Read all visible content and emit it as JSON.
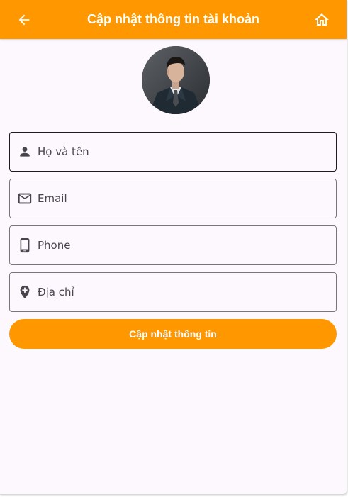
{
  "appbar": {
    "title": "Cập nhật thông tin tài khoản",
    "back_icon": "arrow-back-icon",
    "home_icon": "home-icon",
    "background_color": "#ff9800",
    "text_color": "#ffffff"
  },
  "profile": {
    "avatar_icon": "avatar"
  },
  "form": {
    "fields": [
      {
        "icon": "person-icon",
        "placeholder": "Họ và tên",
        "value": ""
      },
      {
        "icon": "mail-icon",
        "placeholder": "Email",
        "value": ""
      },
      {
        "icon": "phone-icon",
        "placeholder": "Phone",
        "value": ""
      },
      {
        "icon": "location-add-icon",
        "placeholder": "Địa chỉ",
        "value": ""
      }
    ],
    "submit_label": "Cập nhật thông tin"
  },
  "colors": {
    "accent": "#ff9800",
    "page_background": "#fdf8fd",
    "field_border": "#7a757c",
    "focused_border": "#1c1b1f"
  }
}
